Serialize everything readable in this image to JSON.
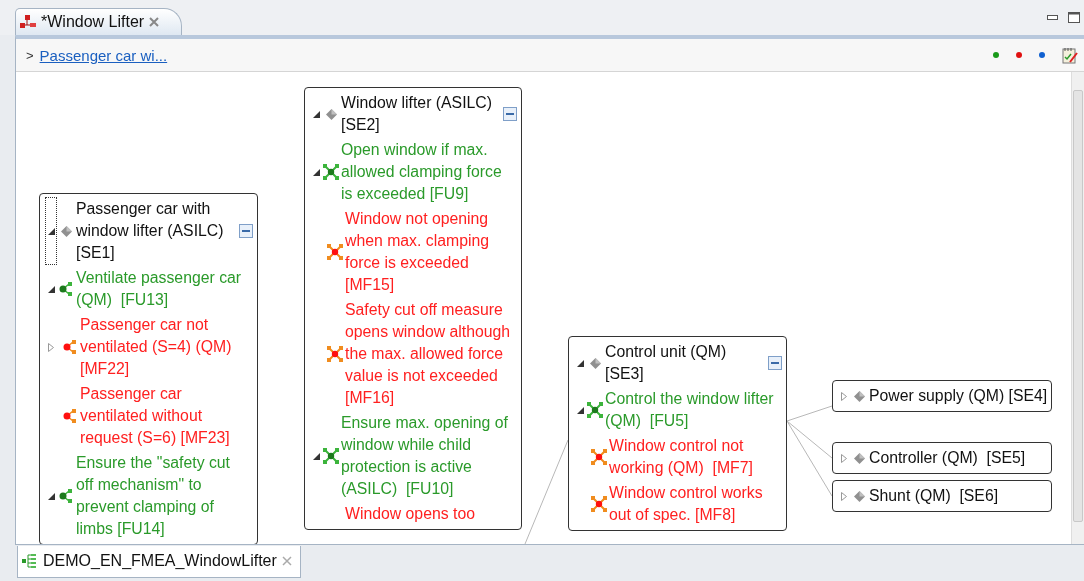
{
  "editor_tab": {
    "title": "*Window Lifter",
    "selected": true
  },
  "breadcrumb": {
    "separator": ">",
    "link": "Passenger car wi..."
  },
  "toolbar": {
    "dots": [
      {
        "color": "#1a9a1a"
      },
      {
        "color": "#e01010"
      },
      {
        "color": "#1060d0"
      }
    ]
  },
  "nodes": [
    {
      "header": {
        "text": "Passenger car with window lifter (ASILC) [SE1]",
        "expanded": true,
        "focused": true,
        "collapse_button": true
      },
      "items": [
        {
          "kind": "function",
          "branched": true,
          "expanded": true,
          "text": "Ventilate passenger car (QM)  [FU13]"
        },
        {
          "kind": "malfunction",
          "branched": true,
          "expanded": false,
          "text": "Passenger car not ventilated (S=4) (QM) [MF22]"
        },
        {
          "kind": "malfunction",
          "branched": true,
          "text": "Passenger car ventilated without request (S=6) [MF23]"
        },
        {
          "kind": "function",
          "branched": true,
          "expanded": true,
          "text": "Ensure the \"safety cut off mechanism\" to prevent clamping of limbs [FU14]"
        }
      ]
    },
    {
      "header": {
        "text": "Window lifter (ASILC) [SE2]",
        "expanded": true,
        "focused": false,
        "collapse_button": true
      },
      "items": [
        {
          "kind": "function",
          "branched": false,
          "expanded": true,
          "text": "Open window if max. allowed clamping force is exceeded [FU9]"
        },
        {
          "kind": "malfunction",
          "branched": false,
          "text": "Window not opening when max. clamping force is exceeded [MF15]"
        },
        {
          "kind": "malfunction",
          "branched": false,
          "text": "Safety cut off measure opens window although the max. allowed force value is not exceeded [MF16]"
        },
        {
          "kind": "function",
          "branched": false,
          "expanded": true,
          "text": "Ensure max. opening of window while child protection is active (ASILC)  [FU10]"
        },
        {
          "kind": "malfunction",
          "text": "Window opens too"
        }
      ]
    },
    {
      "header": {
        "text": "Control unit (QM) [SE3]",
        "expanded": true,
        "focused": false,
        "collapse_button": true
      },
      "items": [
        {
          "kind": "function",
          "branched": false,
          "expanded": true,
          "text": "Control the window lifter (QM)  [FU5]"
        },
        {
          "kind": "malfunction",
          "branched": false,
          "text": "Window control not working (QM)  [MF7]"
        },
        {
          "kind": "malfunction",
          "branched": false,
          "text": "Window control works out of spec. [MF8]"
        }
      ]
    },
    {
      "header": {
        "text": "Power supply (QM) [SE4]",
        "expanded": false,
        "focused": false,
        "collapse_button": false
      }
    },
    {
      "header": {
        "text": "Controller (QM)  [SE5]",
        "expanded": false,
        "focused": false,
        "collapse_button": false
      }
    },
    {
      "header": {
        "text": "Shunt (QM)  [SE6]",
        "expanded": false,
        "focused": false,
        "collapse_button": false
      }
    }
  ],
  "bottom_tab": {
    "title": "DEMO_EN_FMEA_WindowLifter",
    "selected": true
  }
}
